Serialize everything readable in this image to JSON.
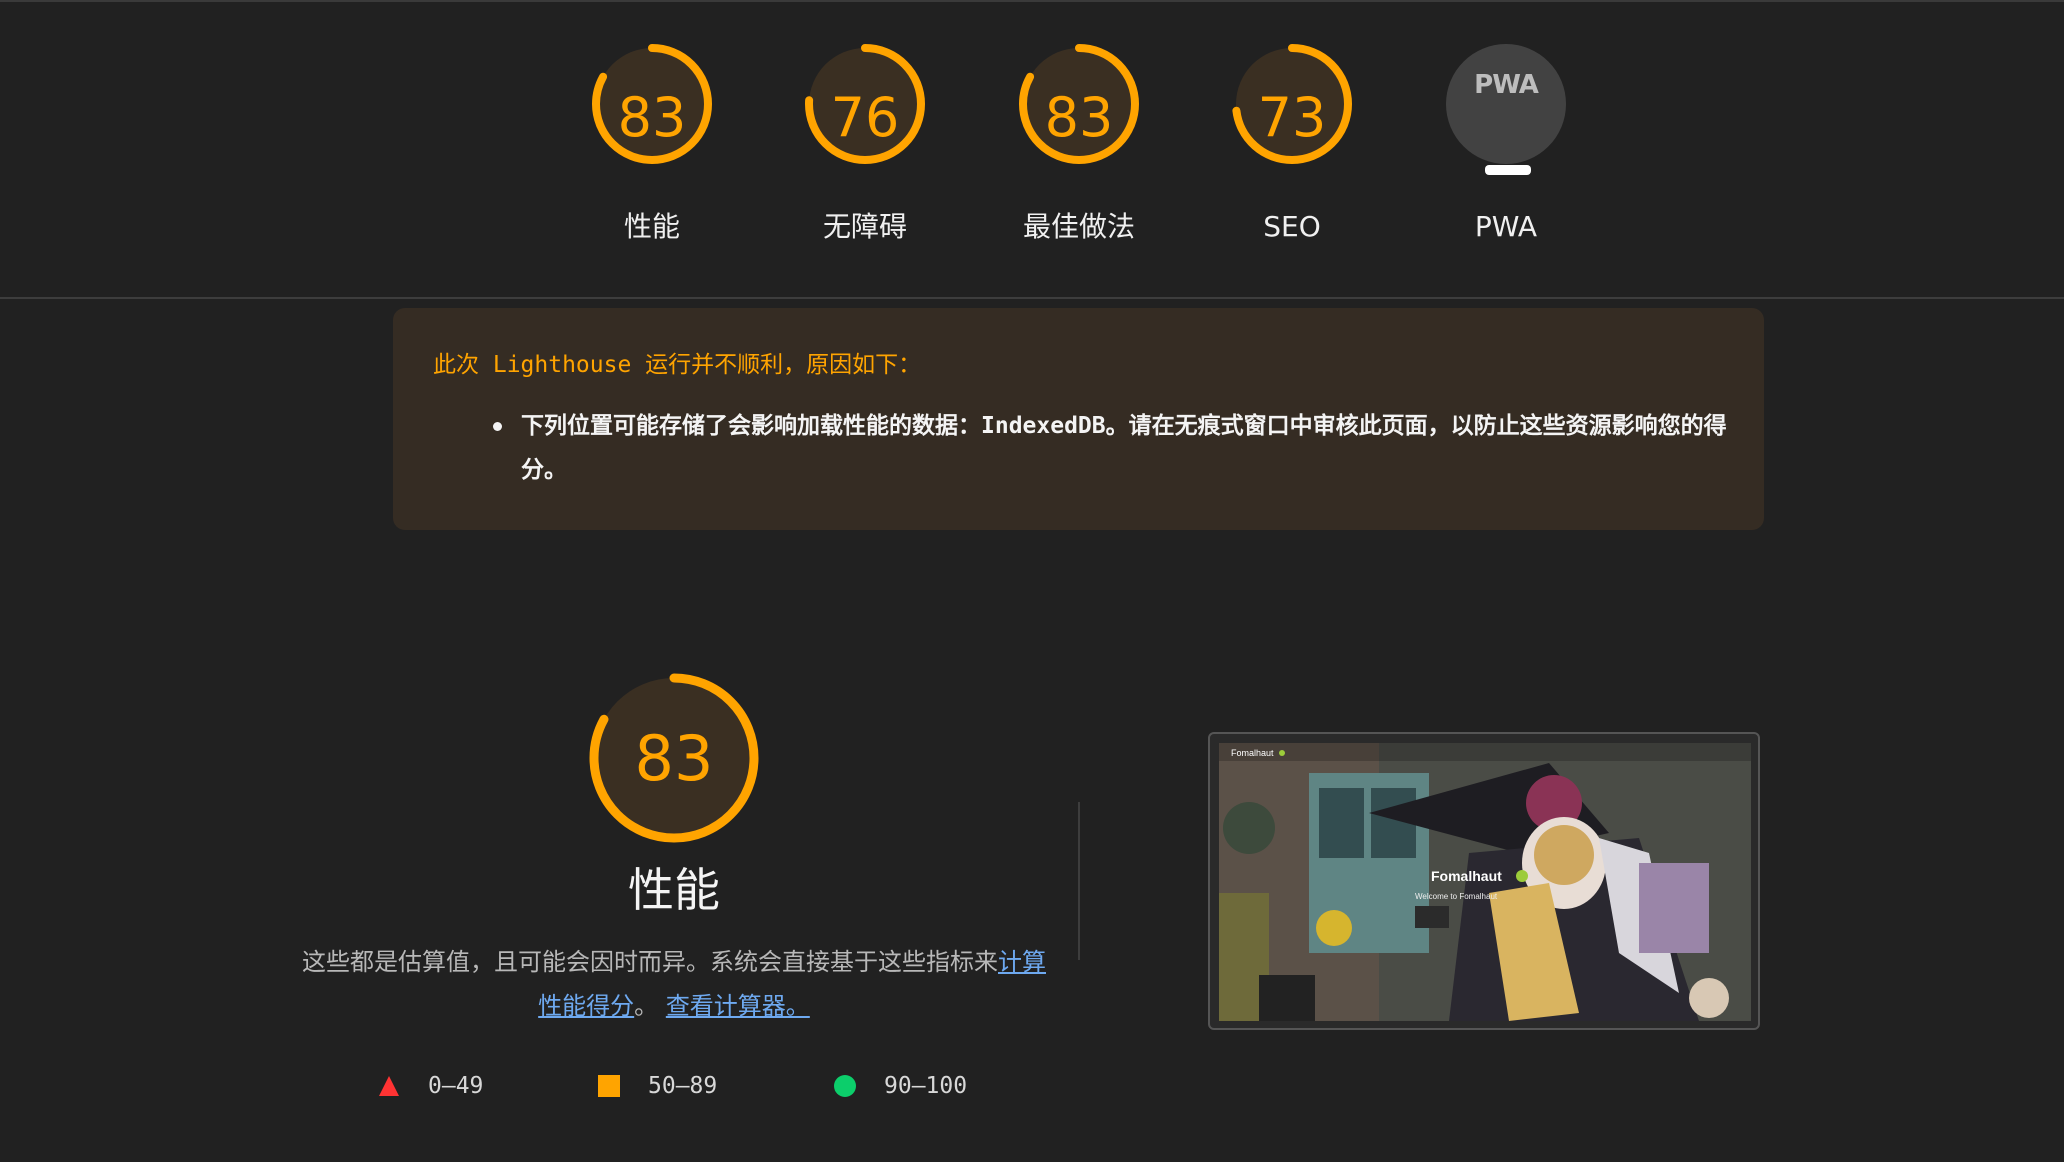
{
  "categories": [
    {
      "label": "性能",
      "score": 83,
      "percent": 0.83
    },
    {
      "label": "无障碍",
      "score": 76,
      "percent": 0.76
    },
    {
      "label": "最佳做法",
      "score": 83,
      "percent": 0.83
    },
    {
      "label": "SEO",
      "score": 73,
      "percent": 0.73
    },
    {
      "label": "PWA",
      "badge": "PWA",
      "score": null
    }
  ],
  "warning": {
    "title": "此次 Lighthouse 运行并不顺利，原因如下：",
    "item": "下列位置可能存储了会影响加载性能的数据：IndexedDB。请在无痕式窗口中审核此页面，以防止这些资源影响您的得分。"
  },
  "performance": {
    "score": 83,
    "percent": 0.83,
    "title": "性能",
    "desc_prefix": "这些都是估算值，且可能会因时而异。系统会直接基于这些指标来",
    "link1": "计算性能得分",
    "desc_mid": "。",
    "link2": "查看计算器。"
  },
  "legend": [
    {
      "range": "0–49",
      "shape": "triangle",
      "color": "#ff3333"
    },
    {
      "range": "50–89",
      "shape": "square",
      "color": "#ffa400"
    },
    {
      "range": "90–100",
      "shape": "circle",
      "color": "#0cce6b"
    }
  ],
  "screenshot": {
    "site_name": "Fomalhaut",
    "subtitle": "Welcome to Fomalhaut"
  },
  "colors": {
    "average": "#ffa400",
    "gauge_bg": "#3a2f22",
    "background": "#212121"
  }
}
